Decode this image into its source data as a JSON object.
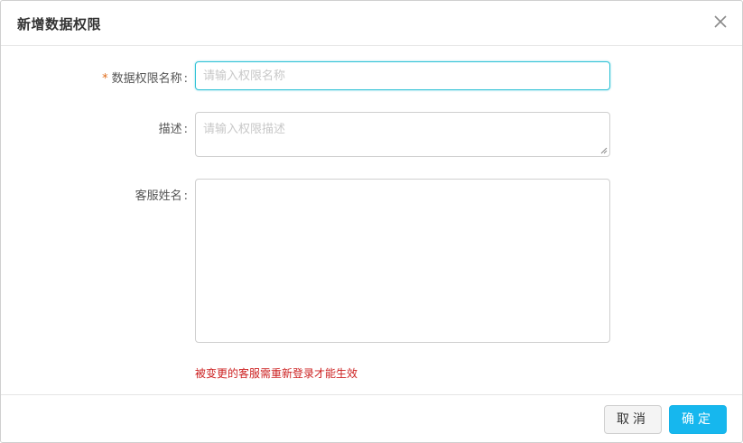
{
  "dialog": {
    "title": "新增数据权限",
    "close_icon": "close-icon"
  },
  "form": {
    "name": {
      "required_mark": "*",
      "label": "数据权限名称",
      "colon": ":",
      "value": "",
      "placeholder": "请输入权限名称",
      "focused": true
    },
    "description": {
      "label": "描述",
      "colon": ":",
      "value": "",
      "placeholder": "请输入权限描述"
    },
    "agents": {
      "label": "客服姓名",
      "colon": ":",
      "value": ""
    },
    "note": "被变更的客服需重新登录才能生效"
  },
  "footer": {
    "cancel_label": "取消",
    "ok_label": "确定"
  },
  "colors": {
    "accent": "#16b7ee",
    "focus_border": "#2fc2d6",
    "required": "#e06c1b",
    "note": "#cc1f1f"
  }
}
